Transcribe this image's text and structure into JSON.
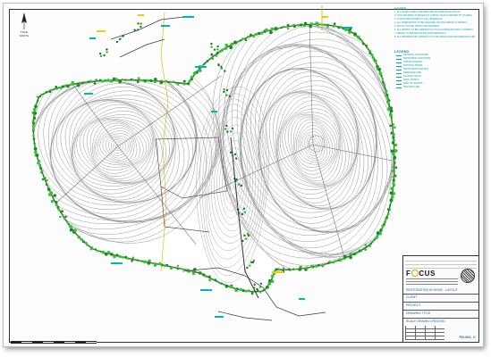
{
  "sheet": {
    "north_label": "TRUE NORTH",
    "notes_title": "NOTES",
    "notes": [
      "1. ALL LEVELS ARE IN METRES ABOVE ORDNANCE DATUM.",
      "2. THIS DRAWING IS BASED ON SURVEY DATA SUPPLIED BY OTHERS.",
      "3. CONTOURS SHOWN AT 1.0m INTERVALS.",
      "4. ALL DIMENSIONS TO BE CHECKED ON SITE PRIOR TO WORKS.",
      "5. DO NOT SCALE FROM THIS DRAWING.",
      "6. ALL WORKS TO BE CARRIED OUT IN ACCORDANCE WITH CONSENT.",
      "7. REFER TO SPECIFICATION FOR MATERIALS.",
      "8. ALL PROPRIETARY PRODUCTS TO BE INSTALLED PER MANUFACTURER."
    ],
    "legend_title": "LEGEND",
    "legend": [
      "EXISTING CONTOURS",
      "PROPOSED CONTOURS",
      "SITE BOUNDARY",
      "EXISTING TREES",
      "PROPOSED PLANTING",
      "DRAINAGE LINE",
      "ACCESS TRACK",
      "SPOT LEVELS",
      "LIMIT OF WORKS",
      "SECTION LINE"
    ],
    "title_block": {
      "company": "FOCUS",
      "project": "RESTORATION SCHEME - LAYOUT",
      "rows": [
        "CLIENT",
        "PROJECT",
        "DRAWING TITLE",
        "SCALE  DRAWN  CHECKED"
      ],
      "drawing_no": "FD-001_C"
    }
  },
  "colors": {
    "contour": "#8a8a8a",
    "tree_green": "#22a32a",
    "boundary": "#ff2020",
    "annotation_cyan": "#00a6a6",
    "track_yellow": "#d8b000"
  }
}
